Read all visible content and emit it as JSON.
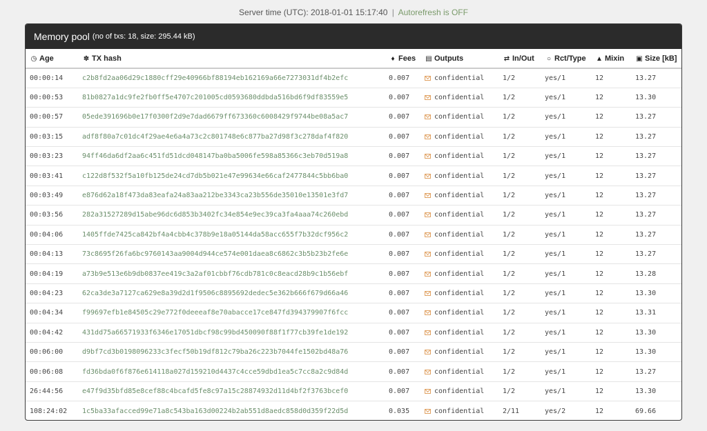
{
  "server_time": {
    "label": "Server time (UTC): 2018-01-01 15:17:40",
    "separator": "|",
    "autorefresh": "Autorefresh is OFF"
  },
  "panel": {
    "title": "Memory pool",
    "subtitle": "(no of txs: 18, size: 295.44 kB)"
  },
  "columns": {
    "age": "Age",
    "hash": "TX hash",
    "fees": "Fees",
    "outputs": "Outputs",
    "inout": "In/Out",
    "rct": "Rct/Type",
    "mixin": "Mixin",
    "size": "Size [kB]"
  },
  "icons": {
    "age": "clock-icon",
    "hash": "paw-icon",
    "fees": "tag-icon",
    "outputs": "money-icon",
    "inout": "exchange-icon",
    "rct": "circle-icon",
    "mixin": "sitemap-icon",
    "size": "floppy-icon",
    "output_cell": "envelope-icon"
  },
  "colors": {
    "header_bg": "#2b2b2b",
    "hash_text": "#6a8e6a",
    "envelope": "#e0a060"
  },
  "rows": [
    {
      "age": "00:00:14",
      "hash": "c2b8fd2aa06d29c1880cff29e40966bf88194eb162169a66e7273031df4b2efc",
      "fees": "0.007",
      "outputs": "confidential",
      "inout": "1/2",
      "rct": "yes/1",
      "mixin": "12",
      "size": "13.27"
    },
    {
      "age": "00:00:53",
      "hash": "81b0827a1dc9fe2fb0ff5e4707c201005cd0593680ddbda516bd6f9df83559e5",
      "fees": "0.007",
      "outputs": "confidential",
      "inout": "1/2",
      "rct": "yes/1",
      "mixin": "12",
      "size": "13.30"
    },
    {
      "age": "00:00:57",
      "hash": "05ede391696b0e17f0300f2d9e7dad6679ff673360c6008429f9744be08a5ac7",
      "fees": "0.007",
      "outputs": "confidential",
      "inout": "1/2",
      "rct": "yes/1",
      "mixin": "12",
      "size": "13.27"
    },
    {
      "age": "00:03:15",
      "hash": "adf8f80a7c01dc4f29ae4e6a4a73c2c801748e6c877ba27d98f3c278daf4f820",
      "fees": "0.007",
      "outputs": "confidential",
      "inout": "1/2",
      "rct": "yes/1",
      "mixin": "12",
      "size": "13.27"
    },
    {
      "age": "00:03:23",
      "hash": "94ff46da6df2aa6c451fd51dcd048147ba0ba5006fe598a85366c3eb70d519a8",
      "fees": "0.007",
      "outputs": "confidential",
      "inout": "1/2",
      "rct": "yes/1",
      "mixin": "12",
      "size": "13.27"
    },
    {
      "age": "00:03:41",
      "hash": "c122d8f532f5a10fb125de24cd7db5b021e47e99634e66caf2477844c5bb6ba0",
      "fees": "0.007",
      "outputs": "confidential",
      "inout": "1/2",
      "rct": "yes/1",
      "mixin": "12",
      "size": "13.27"
    },
    {
      "age": "00:03:49",
      "hash": "e876d62a18f473da83eafa24a83aa212be3343ca23b556de35010e13501e3fd7",
      "fees": "0.007",
      "outputs": "confidential",
      "inout": "1/2",
      "rct": "yes/1",
      "mixin": "12",
      "size": "13.27"
    },
    {
      "age": "00:03:56",
      "hash": "282a31527289d15abe96dc6d853b3402fc34e854e9ec39ca3fa4aaa74c260ebd",
      "fees": "0.007",
      "outputs": "confidential",
      "inout": "1/2",
      "rct": "yes/1",
      "mixin": "12",
      "size": "13.27"
    },
    {
      "age": "00:04:06",
      "hash": "1405ffde7425ca842bf4a4cbb4c378b9e18a05144da58acc655f7b32dcf956c2",
      "fees": "0.007",
      "outputs": "confidential",
      "inout": "1/2",
      "rct": "yes/1",
      "mixin": "12",
      "size": "13.27"
    },
    {
      "age": "00:04:13",
      "hash": "73c8695f26fa6bc9760143aa9004d944ce574e001daea8c6862c3b5b23b2fe6e",
      "fees": "0.007",
      "outputs": "confidential",
      "inout": "1/2",
      "rct": "yes/1",
      "mixin": "12",
      "size": "13.27"
    },
    {
      "age": "00:04:19",
      "hash": "a73b9e513e6b9db0837ee419c3a2af01cbbf76cdb781c0c8eacd28b9c1b56ebf",
      "fees": "0.007",
      "outputs": "confidential",
      "inout": "1/2",
      "rct": "yes/1",
      "mixin": "12",
      "size": "13.28"
    },
    {
      "age": "00:04:23",
      "hash": "62ca3de3a7127ca629e8a39d2d1f9506c8895692dedec5e362b666f679d66a46",
      "fees": "0.007",
      "outputs": "confidential",
      "inout": "1/2",
      "rct": "yes/1",
      "mixin": "12",
      "size": "13.30"
    },
    {
      "age": "00:04:34",
      "hash": "f99697efb1e84505c29e772f0deeeaf8e70abacce17ce847fd394379907f6fcc",
      "fees": "0.007",
      "outputs": "confidential",
      "inout": "1/2",
      "rct": "yes/1",
      "mixin": "12",
      "size": "13.31"
    },
    {
      "age": "00:04:42",
      "hash": "431dd75a66571933f6346e17051dbcf98c99bd450090f88f1f77cb39fe1de192",
      "fees": "0.007",
      "outputs": "confidential",
      "inout": "1/2",
      "rct": "yes/1",
      "mixin": "12",
      "size": "13.30"
    },
    {
      "age": "00:06:00",
      "hash": "d9bf7cd3b0198096233c3fecf50b19df812c79ba26c223b7044fe1502bd48a76",
      "fees": "0.007",
      "outputs": "confidential",
      "inout": "1/2",
      "rct": "yes/1",
      "mixin": "12",
      "size": "13.30"
    },
    {
      "age": "00:06:08",
      "hash": "fd36bda0f6f876e614118a027d159210d4437c4cce59dbd1ea5c7cc8a2c9d84d",
      "fees": "0.007",
      "outputs": "confidential",
      "inout": "1/2",
      "rct": "yes/1",
      "mixin": "12",
      "size": "13.27"
    },
    {
      "age": "26:44:56",
      "hash": "e47f9d35bfd85e8cef88c4bcafd5fe8c97a15c28874932d11d4bf2f3763bcef0",
      "fees": "0.007",
      "outputs": "confidential",
      "inout": "1/2",
      "rct": "yes/1",
      "mixin": "12",
      "size": "13.30"
    },
    {
      "age": "108:24:02",
      "hash": "1c5ba33afacced99e71a8c543ba163d00224b2ab551d8aedc858d0d359f22d5d",
      "fees": "0.035",
      "outputs": "confidential",
      "inout": "2/11",
      "rct": "yes/2",
      "mixin": "12",
      "size": "69.66"
    }
  ]
}
